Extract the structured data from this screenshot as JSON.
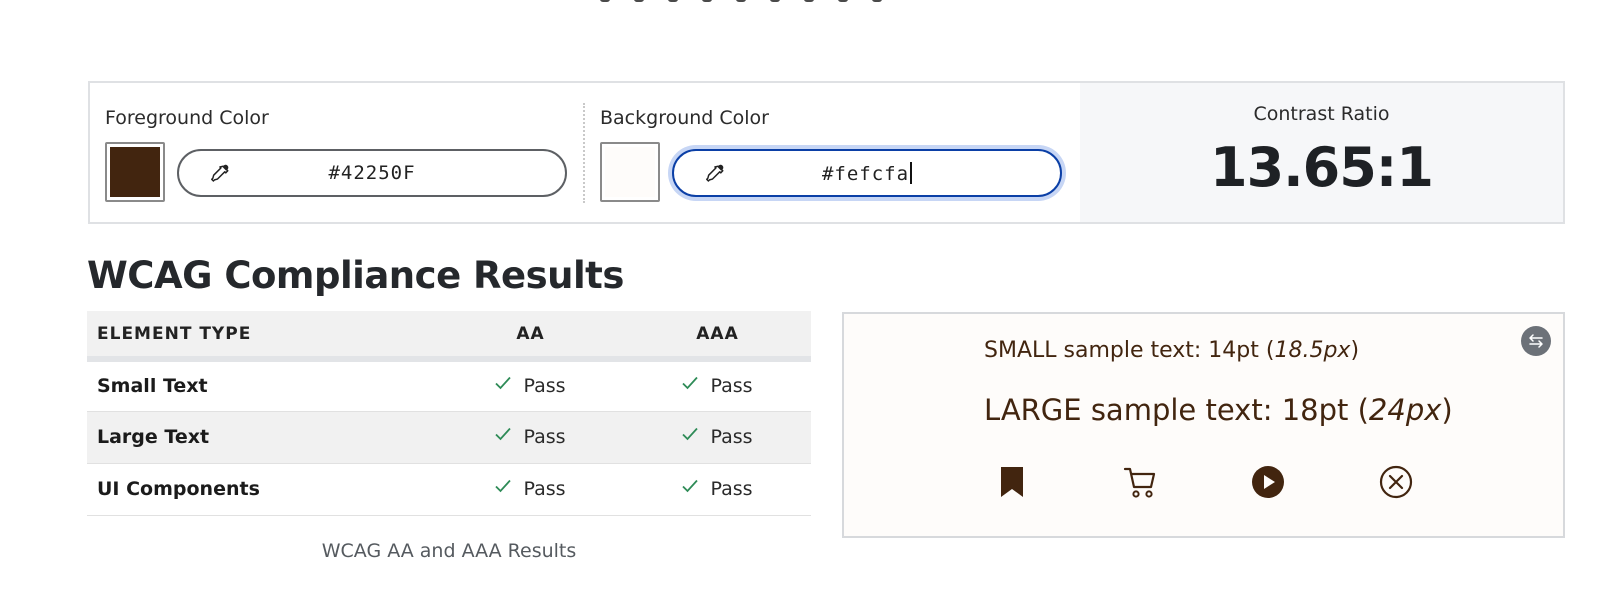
{
  "colors": {
    "foreground": "#42250F",
    "background": "#fefcfa",
    "focus_ring": "#0b3fa6",
    "pass_check": "#2e8b57"
  },
  "picker": {
    "foreground": {
      "label": "Foreground Color",
      "value": "#42250F",
      "icon": "eyedropper-icon"
    },
    "background": {
      "label": "Background Color",
      "value": "#fefcfa",
      "icon": "eyedropper-icon"
    },
    "contrast": {
      "label": "Contrast Ratio",
      "value": "13.65:1"
    }
  },
  "results": {
    "title": "WCAG Compliance Results",
    "headers": [
      "ELEMENT TYPE",
      "AA",
      "AAA"
    ],
    "rows": [
      {
        "type": "Small Text",
        "aa": "Pass",
        "aaa": "Pass"
      },
      {
        "type": "Large Text",
        "aa": "Pass",
        "aaa": "Pass"
      },
      {
        "type": "UI Components",
        "aa": "Pass",
        "aaa": "Pass"
      }
    ],
    "caption": "WCAG AA and AAA Results"
  },
  "preview": {
    "small_prefix": "SMALL sample text: 14pt (",
    "small_px": "18.5px",
    "suffix": ")",
    "large_prefix": "LARGE sample text: 18pt (",
    "large_px": "24px",
    "icons": [
      "bookmark-icon",
      "cart-icon",
      "play-icon",
      "close-circle-icon"
    ],
    "swap_icon": "swap-icon"
  }
}
